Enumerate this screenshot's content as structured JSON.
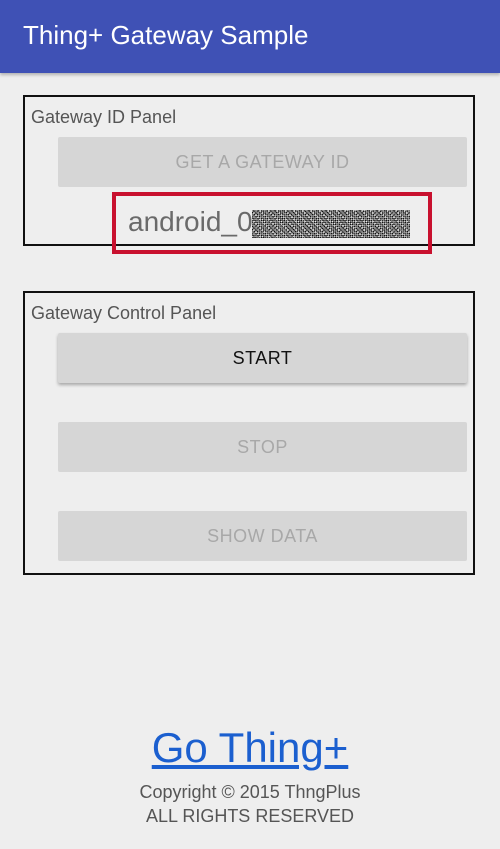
{
  "app_bar": {
    "title": "Thing+ Gateway Sample",
    "color": "#3f51b5"
  },
  "gateway_id_panel": {
    "label": "Gateway ID Panel",
    "get_id_button": "GET A GATEWAY ID",
    "get_id_button_enabled": false,
    "gateway_id_visible": "android_0",
    "gateway_id_redacted": true,
    "highlight_color": "#c8102e"
  },
  "gateway_control_panel": {
    "label": "Gateway Control Panel",
    "start_button": "START",
    "start_enabled": true,
    "stop_button": "STOP",
    "stop_enabled": false,
    "show_data_button": "SHOW DATA",
    "show_data_enabled": false
  },
  "footer": {
    "link_text": "Go Thing+",
    "copyright_line1": "Copyright © 2015 ThngPlus",
    "copyright_line2": "ALL RIGHTS RESERVED"
  }
}
